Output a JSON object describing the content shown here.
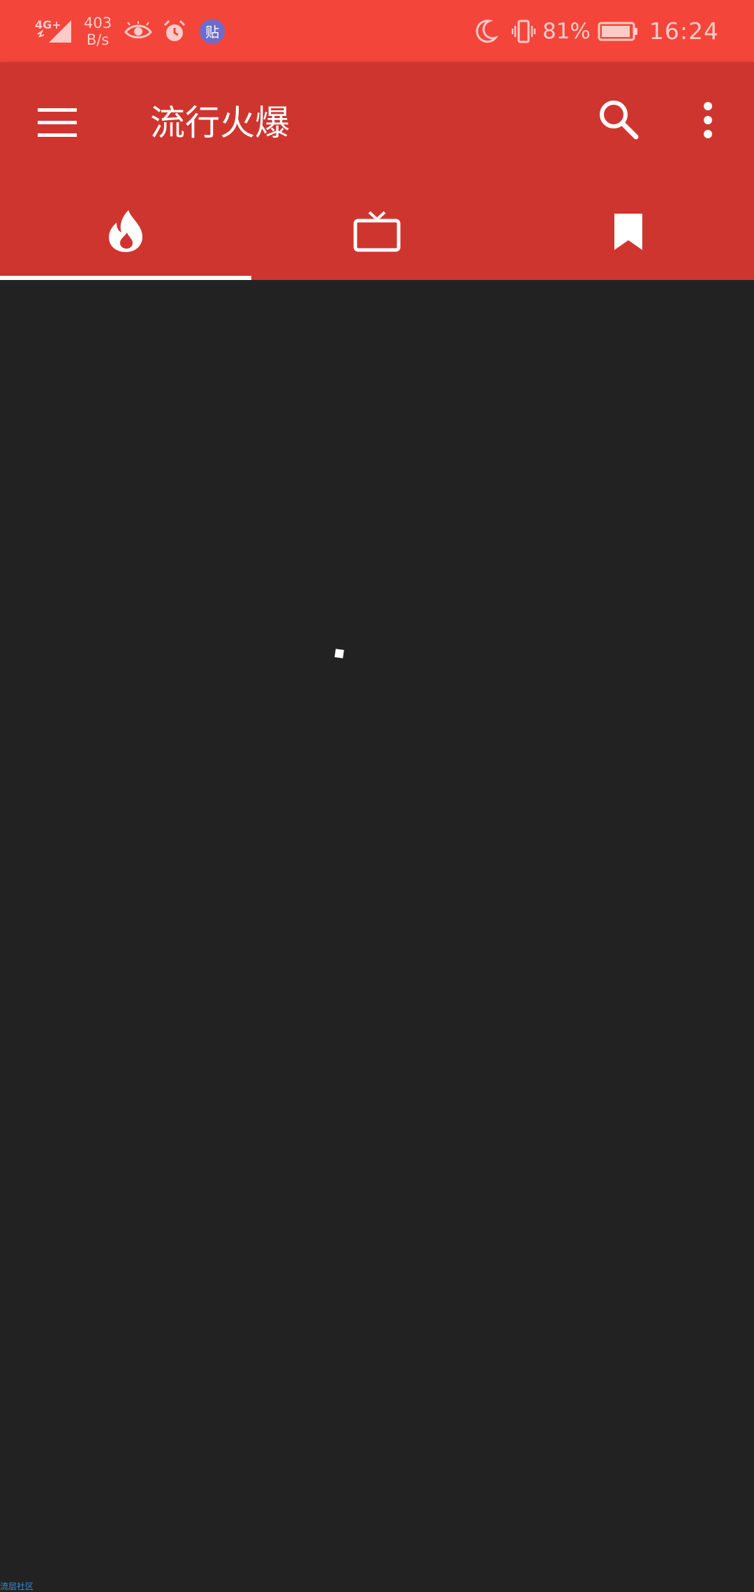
{
  "status_bar": {
    "network_type": "4G+",
    "net_speed_value": "403",
    "net_speed_unit": "B/s",
    "baidu_badge": "贴",
    "battery_percent": "81%",
    "time": "16:24",
    "icons": [
      "signal-icon",
      "eye-icon",
      "alarm-icon",
      "baidu-tieba-icon",
      "moon-icon",
      "vibrate-icon",
      "battery-icon"
    ]
  },
  "toolbar": {
    "title": "流行火爆",
    "menu_icon": "hamburger-menu-icon",
    "search_icon": "search-icon",
    "more_icon": "more-vert-icon"
  },
  "tabs": [
    {
      "icon": "flame-icon",
      "selected": true
    },
    {
      "icon": "tv-icon",
      "selected": false
    },
    {
      "icon": "bookmark-icon",
      "selected": false
    }
  ],
  "footer": {
    "label": "流层社区"
  },
  "colors": {
    "status_bar": "#f4453b",
    "app_bar": "#cf352f",
    "background": "#222222",
    "tab_indicator": "#ffffff",
    "footer_text": "#3a8ee6"
  }
}
